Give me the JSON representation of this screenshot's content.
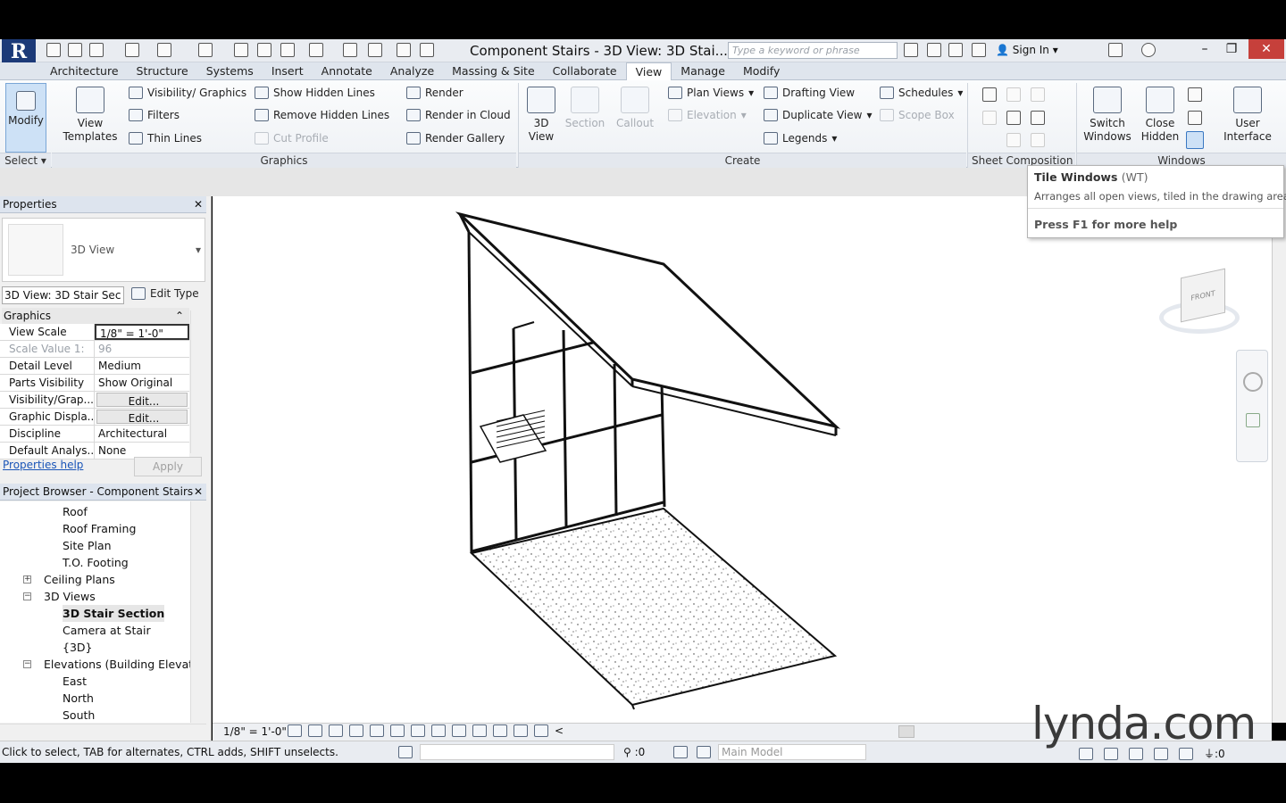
{
  "app": {
    "logo_text": "R",
    "document_title": "Component Stairs - 3D View: 3D Stai...",
    "search_placeholder": "Type a keyword or phrase",
    "sign_in": "Sign In"
  },
  "tabs": [
    "Architecture",
    "Structure",
    "Systems",
    "Insert",
    "Annotate",
    "Analyze",
    "Massing & Site",
    "Collaborate",
    "View",
    "Manage",
    "Modify"
  ],
  "active_tab": "View",
  "ribbon": {
    "modify": "Modify",
    "view_templates_line1": "View",
    "view_templates_line2": "Templates",
    "visibility_graphics": "Visibility/ Graphics",
    "filters": "Filters",
    "thin_lines": "Thin  Lines",
    "show_hidden_lines": "Show  Hidden Lines",
    "remove_hidden_lines": "Remove  Hidden Lines",
    "cut_profile": "Cut  Profile",
    "render": "Render",
    "render_in_cloud": "Render  in Cloud",
    "render_gallery": "Render  Gallery",
    "view_3d_line1": "3D",
    "view_3d_line2": "View",
    "section": "Section",
    "callout": "Callout",
    "plan_views": "Plan  Views",
    "elevation": "Elevation",
    "drafting_view": "Drafting  View",
    "duplicate_view": "Duplicate  View",
    "legends": "Legends",
    "schedules": "Schedules",
    "scope_box": "Scope  Box",
    "switch_windows_line1": "Switch",
    "switch_windows_line2": "Windows",
    "close_hidden_line1": "Close",
    "close_hidden_line2": "Hidden",
    "user_interface_line1": "User",
    "user_interface_line2": "Interface",
    "panel_select": "Select",
    "panel_graphics": "Graphics",
    "panel_create": "Create",
    "panel_sheet": "Sheet Composition",
    "panel_windows": "Windows"
  },
  "tooltip": {
    "title": "Tile Windows",
    "shortcut": "(WT)",
    "description": "Arranges all open views, tiled in the drawing area.",
    "help": "Press F1 for more help"
  },
  "properties": {
    "header": "Properties",
    "type_name": "3D View",
    "instance_selector": "3D View: 3D Stair Sec",
    "edit_type": "Edit Type",
    "group": "Graphics",
    "rows": [
      {
        "k": "View Scale",
        "v": "1/8\" = 1'-0\""
      },
      {
        "k": "Scale Value    1:",
        "v": "96"
      },
      {
        "k": "Detail Level",
        "v": "Medium"
      },
      {
        "k": "Parts Visibility",
        "v": "Show Original"
      },
      {
        "k": "Visibility/Grap...",
        "v": "Edit..."
      },
      {
        "k": "Graphic Displa...",
        "v": "Edit..."
      },
      {
        "k": "Discipline",
        "v": "Architectural"
      },
      {
        "k": "Default Analys...",
        "v": "None"
      }
    ],
    "help_link": "Properties help",
    "apply": "Apply"
  },
  "browser": {
    "header": "Project Browser - Component Stairs",
    "items": [
      {
        "label": "Roof",
        "level": 2
      },
      {
        "label": "Roof Framing",
        "level": 2
      },
      {
        "label": "Site Plan",
        "level": 2
      },
      {
        "label": "T.O. Footing",
        "level": 2
      },
      {
        "label": "Ceiling Plans",
        "level": 1,
        "expander": "+"
      },
      {
        "label": "3D Views",
        "level": 1,
        "expander": "−"
      },
      {
        "label": "3D Stair Section",
        "level": 2,
        "selected": true
      },
      {
        "label": "Camera at Stair",
        "level": 2
      },
      {
        "label": "{3D}",
        "level": 2
      },
      {
        "label": "Elevations (Building Elevation",
        "level": 1,
        "expander": "−"
      },
      {
        "label": "East",
        "level": 2
      },
      {
        "label": "North",
        "level": 2
      },
      {
        "label": "South",
        "level": 2
      }
    ]
  },
  "view_control": {
    "scale": "1/8\" = 1'-0\""
  },
  "status": {
    "message": "Click to select, TAB for alternates, CTRL adds, SHIFT unselects.",
    "filter_count": ":0",
    "workset": "Main Model",
    "selection_count": ":0"
  },
  "viewcube": {
    "face": "FRONT"
  },
  "watermark": "lynda.com",
  "colors": {
    "ribbon_bg": "#eef1f5",
    "active_tab": "#ffffff",
    "close_button": "#c6403b",
    "panel_header": "#dde4ee"
  }
}
